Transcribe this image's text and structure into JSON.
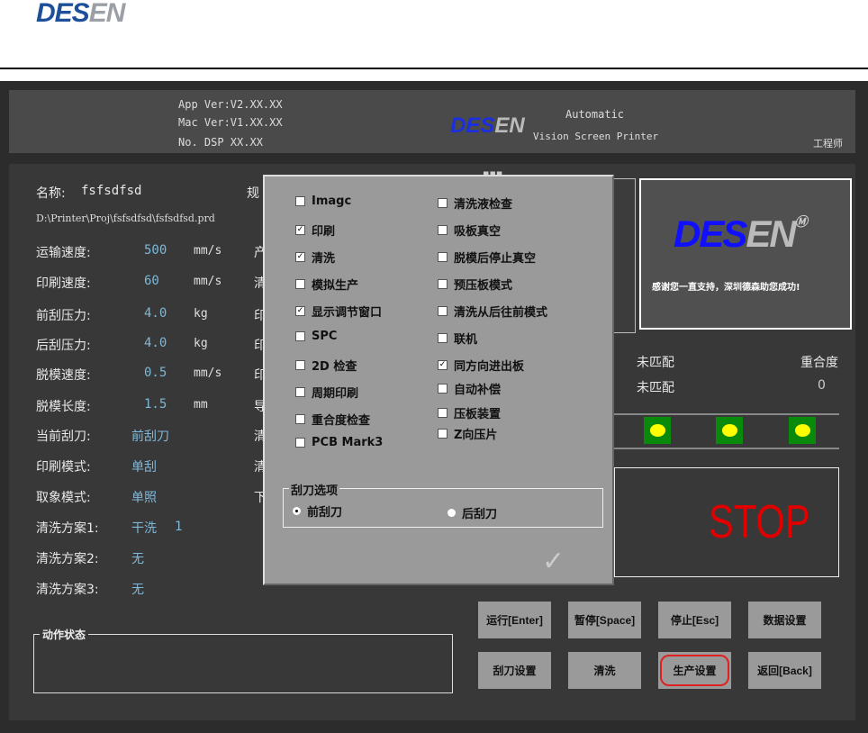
{
  "brand": {
    "logo_text_a": "DES",
    "logo_text_b": "EN"
  },
  "header": {
    "app_ver": "App Ver:V2.XX.XX",
    "mac_ver": "Mac Ver:V1.XX.XX",
    "dsp_ver": "No. DSP XX.XX",
    "title_line1": "Automatic",
    "title_line2": "Vision Screen Printer",
    "user_role": "工程师"
  },
  "left": {
    "name_label": "名称:",
    "name_value": "fsfsdfsd",
    "path": "D:\\Printer\\Proj\\fsfsdfsd\\fsfsdfsd.prd",
    "params": [
      {
        "label": "运输速度:",
        "value": "500",
        "unit": "mm/s"
      },
      {
        "label": "印刷速度:",
        "value": "60",
        "unit": "mm/s"
      },
      {
        "label": "前刮压力:",
        "value": "4.0",
        "unit": "kg"
      },
      {
        "label": "后刮压力:",
        "value": "4.0",
        "unit": "kg"
      },
      {
        "label": "脱模速度:",
        "value": "0.5",
        "unit": "mm/s"
      },
      {
        "label": "脱模长度:",
        "value": "1.5",
        "unit": "mm"
      },
      {
        "label": "当前刮刀:",
        "value": "前刮刀",
        "unit": ""
      },
      {
        "label": "印刷模式:",
        "value": "单刮",
        "unit": ""
      },
      {
        "label": "取象模式:",
        "value": "单照",
        "unit": ""
      },
      {
        "label": "清洗方案1:",
        "value": "干洗",
        "unit": "1"
      },
      {
        "label": "清洗方案2:",
        "value": "无",
        "unit": ""
      },
      {
        "label": "清洗方案3:",
        "value": "无",
        "unit": ""
      }
    ],
    "mid_partial": [
      "规",
      "产",
      "清",
      "印",
      "印",
      "印",
      "导",
      "清",
      "清",
      "下"
    ]
  },
  "action_status": {
    "title": "动作状态"
  },
  "dialog": {
    "col1": [
      {
        "label": "Imagc",
        "checked": false
      },
      {
        "label": "印刷",
        "checked": true
      },
      {
        "label": "清洗",
        "checked": true
      },
      {
        "label": "模拟生产",
        "checked": false
      },
      {
        "label": "显示调节窗口",
        "checked": true
      },
      {
        "label": "SPC",
        "checked": false
      },
      {
        "label": "2D 检查",
        "checked": false
      },
      {
        "label": "周期印刷",
        "checked": false
      },
      {
        "label": "重合度检查",
        "checked": false
      },
      {
        "label": "PCB Mark3",
        "checked": false
      }
    ],
    "col2": [
      {
        "label": "清洗液检查",
        "checked": false
      },
      {
        "label": "吸板真空",
        "checked": false
      },
      {
        "label": "脱模后停止真空",
        "checked": false
      },
      {
        "label": "预压板模式",
        "checked": false
      },
      {
        "label": "清洗从后往前模式",
        "checked": false
      },
      {
        "label": "联机",
        "checked": false
      },
      {
        "label": "同方向进出板",
        "checked": true
      },
      {
        "label": "自动补偿",
        "checked": false
      },
      {
        "label": "压板装置",
        "checked": false
      },
      {
        "label": "Z向压片",
        "checked": false
      }
    ],
    "squeegee_group": "刮刀选项",
    "radio_front": "前刮刀",
    "radio_back": "后刮刀",
    "selected": "前刮刀"
  },
  "right": {
    "thanks": "感谢您一直支持，深圳德森助您成功!",
    "match1": "未匹配",
    "overlap_label": "重合度",
    "match2": "未匹配",
    "overlap_value": "0",
    "status": "STOP",
    "status_color": "#e00000"
  },
  "buttons": [
    "运行[Enter]",
    "暂停[Space]",
    "停止[Esc]",
    "数据设置",
    "刮刀设置",
    "清洗",
    "生产设置",
    "返回[Back]"
  ]
}
